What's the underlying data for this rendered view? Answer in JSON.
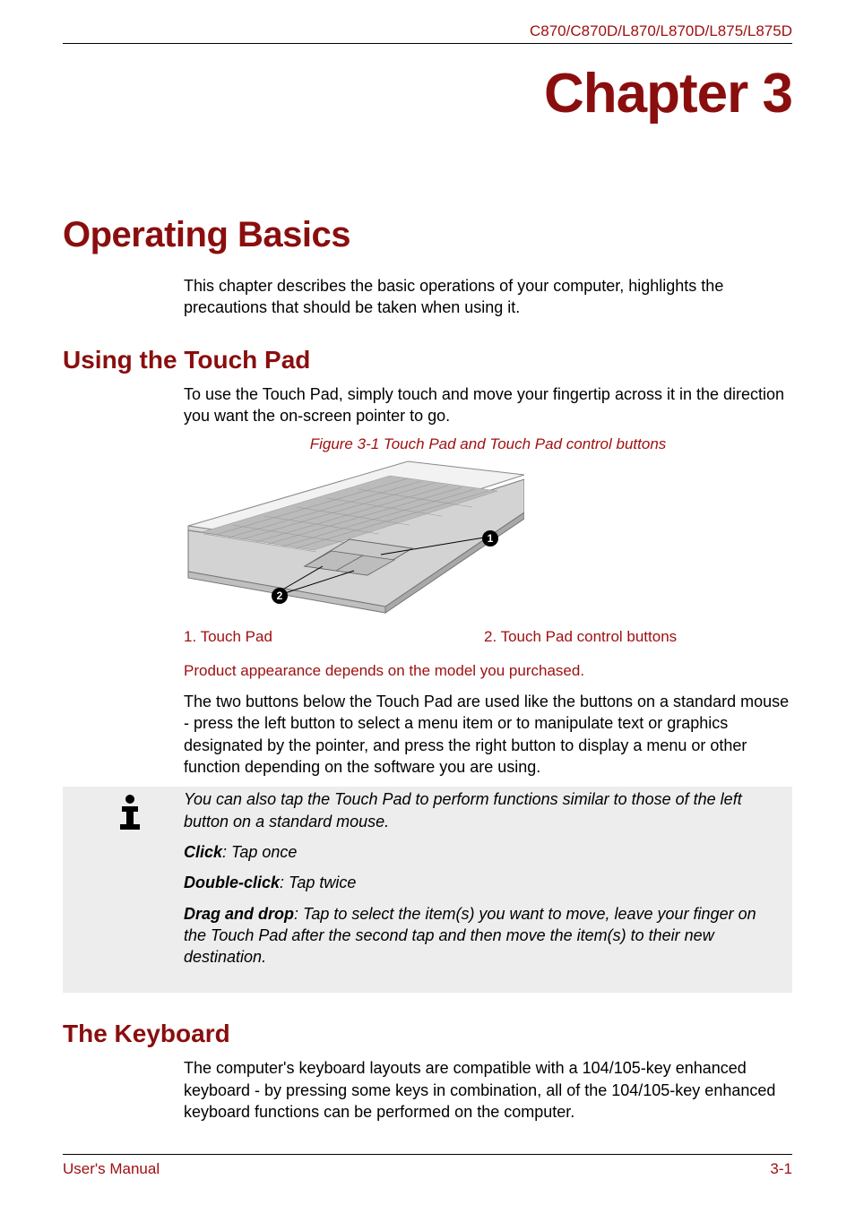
{
  "header": {
    "model_line": "C870/C870D/L870/L870D/L875/L875D"
  },
  "chapter": {
    "label": "Chapter 3"
  },
  "title": "Operating Basics",
  "intro_para": "This chapter describes the basic operations of your computer, highlights the precautions that should be taken when using it.",
  "sections": {
    "touchpad": {
      "heading": "Using the Touch Pad",
      "para1": "To use the Touch Pad, simply touch and move your fingertip across it in the direction you want the on-screen pointer to go.",
      "figure_caption": "Figure 3-1 Touch Pad and Touch Pad control buttons",
      "callout1": "1",
      "callout2": "2",
      "legend1": "1. Touch Pad",
      "legend2": "2. Touch Pad control buttons",
      "red_note": "Product appearance depends on the model you purchased.",
      "para2": "The two buttons below the Touch Pad are used like the buttons on a standard mouse - press the left button to select a menu item or to manipulate text or graphics designated by the pointer, and press the right button to display a menu or other function depending on the software you are using.",
      "info_intro": "You can also tap the Touch Pad to perform functions similar to those of the left button on a standard mouse.",
      "info_click_label": "Click",
      "info_click_rest": ": Tap once",
      "info_dbl_label": "Double-click",
      "info_dbl_rest": ": Tap twice",
      "info_dd_label": "Drag and drop",
      "info_dd_rest": ": Tap to select the item(s) you want to move, leave your finger on the Touch Pad after the second tap and then move the item(s) to their new destination."
    },
    "keyboard": {
      "heading": "The Keyboard",
      "para1": "The computer's keyboard layouts are compatible with a 104/105-key enhanced keyboard - by pressing some keys in combination, all of the 104/105-key enhanced keyboard functions can be performed on the computer."
    }
  },
  "footer": {
    "left": "User's Manual",
    "right": "3-1"
  }
}
